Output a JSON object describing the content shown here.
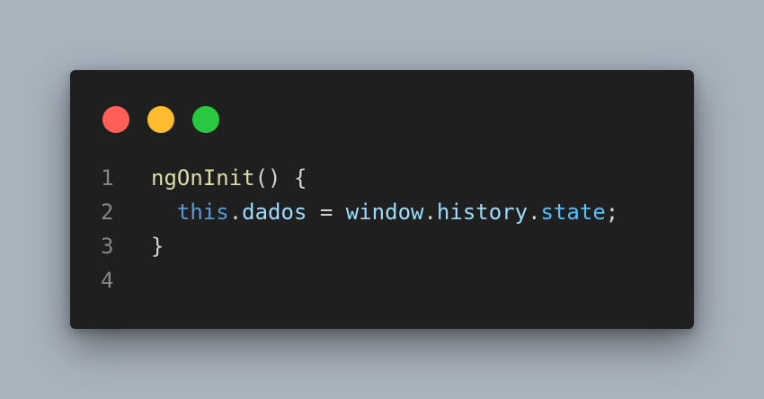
{
  "window": {
    "dots": [
      {
        "name": "close-dot",
        "color": "#ff5f57"
      },
      {
        "name": "minimize-dot",
        "color": "#febc2e"
      },
      {
        "name": "maximize-dot",
        "color": "#28c840"
      }
    ]
  },
  "colors": {
    "background": "#a9b3be",
    "editor_bg": "#1f1f1f",
    "line_number": "#858585",
    "default_text": "#d4d4d4",
    "function": "#dcdcaa",
    "keyword_blue": "#569cd6",
    "property": "#9cdcfe",
    "property_bright": "#4fc1ff"
  },
  "code": {
    "lines": [
      {
        "number": "1",
        "tokens": [
          {
            "text": "ngOnInit",
            "color": "#dcdcaa"
          },
          {
            "text": "() {",
            "color": "#d4d4d4"
          }
        ]
      },
      {
        "number": "2",
        "tokens": [
          {
            "text": "  ",
            "color": "#d4d4d4"
          },
          {
            "text": "this",
            "color": "#569cd6"
          },
          {
            "text": ".",
            "color": "#d4d4d4"
          },
          {
            "text": "dados",
            "color": "#9cdcfe"
          },
          {
            "text": " = ",
            "color": "#d4d4d4"
          },
          {
            "text": "window",
            "color": "#9cdcfe"
          },
          {
            "text": ".",
            "color": "#d4d4d4"
          },
          {
            "text": "history",
            "color": "#9cdcfe"
          },
          {
            "text": ".",
            "color": "#d4d4d4"
          },
          {
            "text": "state",
            "color": "#4fc1ff"
          },
          {
            "text": ";",
            "color": "#d4d4d4"
          }
        ]
      },
      {
        "number": "3",
        "tokens": [
          {
            "text": "}",
            "color": "#d4d4d4"
          }
        ]
      },
      {
        "number": "4",
        "tokens": []
      }
    ]
  }
}
